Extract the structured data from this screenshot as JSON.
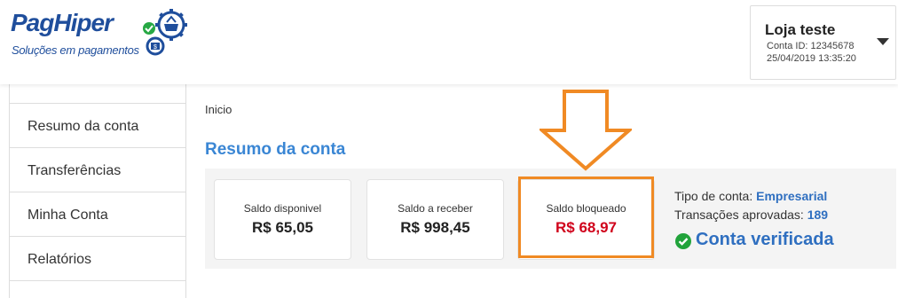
{
  "brand": {
    "name": "PagHiper",
    "tagline": "Soluções em pagamentos",
    "color": "#1f4e9c"
  },
  "store": {
    "name": "Loja teste",
    "account_id": "Conta ID: 12345678",
    "datetime": "25/04/2019 13:35:20"
  },
  "sidebar": {
    "items": [
      {
        "label": "Resumo da conta"
      },
      {
        "label": "Transferências"
      },
      {
        "label": "Minha Conta"
      },
      {
        "label": "Relatórios"
      }
    ]
  },
  "breadcrumb": "Inicio",
  "page_title": "Resumo da conta",
  "balances": [
    {
      "label": "Saldo disponivel",
      "value": "R$ 65,05"
    },
    {
      "label": "Saldo a receber",
      "value": "R$ 998,45"
    },
    {
      "label": "Saldo bloqueado",
      "value": "R$ 68,97",
      "color": "#d0021b"
    }
  ],
  "account_info": {
    "type_label": "Tipo de conta:",
    "type_value": "Empresarial",
    "transactions_label": "Transações aprovadas:",
    "transactions_value": "189",
    "verified_text": "Conta verificada"
  },
  "colors": {
    "accent": "#3a86d4",
    "highlight": "#f08a24",
    "verified": "#21a33b"
  }
}
